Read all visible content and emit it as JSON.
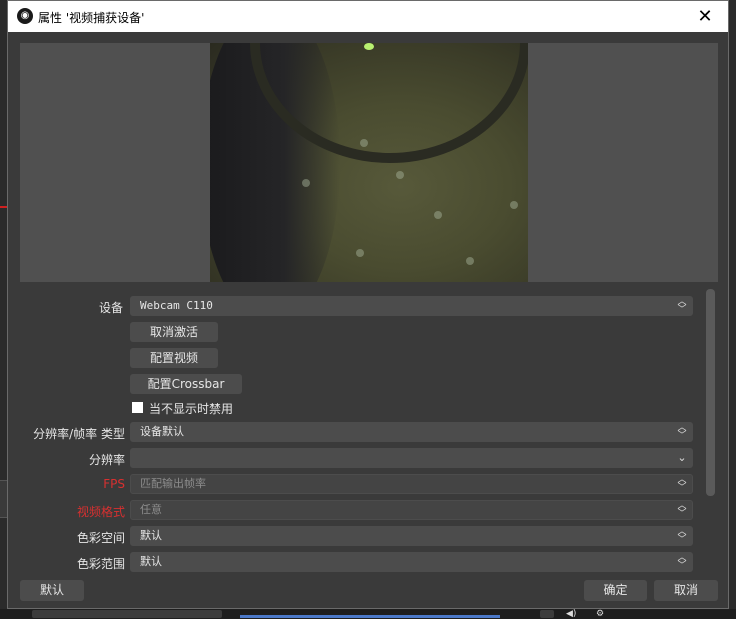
{
  "window": {
    "title": "属性 '视频捕获设备'",
    "close_glyph": "✕",
    "app_icon": "obs-logo-icon"
  },
  "form": {
    "device": {
      "label": "设备",
      "value": "Webcam C110"
    },
    "buttons": {
      "deactivate": "取消激活",
      "config_video": "配置视频",
      "config_crossbar": "配置Crossbar"
    },
    "checkbox": {
      "label": "当不显示时禁用",
      "checked": false
    },
    "resolution_fps_type": {
      "label": "分辨率/帧率 类型",
      "value": "设备默认"
    },
    "resolution": {
      "label": "分辨率",
      "value": ""
    },
    "fps": {
      "label": "FPS",
      "value": "匹配输出帧率"
    },
    "video_format": {
      "label": "视频格式",
      "value": "任意"
    },
    "color_space": {
      "label": "色彩空间",
      "value": "默认"
    },
    "color_range": {
      "label": "色彩范围",
      "value": "默认"
    }
  },
  "footer": {
    "defaults": "默认",
    "ok": "确定",
    "cancel": "取消"
  },
  "colors": {
    "dialog_bg": "#3a3a3a",
    "preview_bg": "#505050",
    "field_bg": "#4c4c4c",
    "disabled_label": "#d83030"
  }
}
